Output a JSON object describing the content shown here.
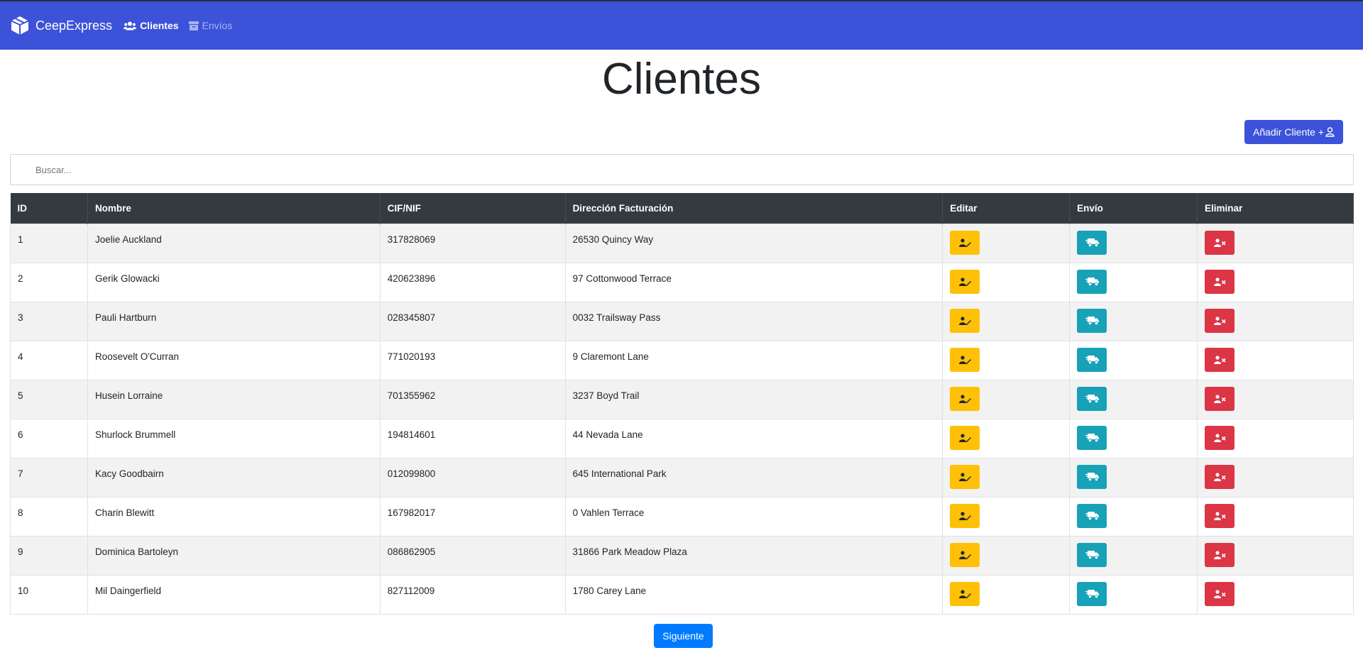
{
  "navbar": {
    "brand": "CeepExpress",
    "links": [
      {
        "label": "Clientes",
        "icon": "users-icon",
        "active": true
      },
      {
        "label": "Envíos",
        "icon": "box-icon",
        "active": false
      }
    ],
    "color": "#3c52d9"
  },
  "page": {
    "title": "Clientes",
    "add_button": "Añadir Cliente +",
    "search_placeholder": "Buscar...",
    "next_button": "Siguiente"
  },
  "table": {
    "headers": [
      "ID",
      "Nombre",
      "CIF/NIF",
      "Dirección Facturación",
      "Editar",
      "Envío",
      "Eliminar"
    ],
    "rows": [
      {
        "id": "1",
        "name": "Joelie Auckland",
        "cif": "317828069",
        "address": "26530 Quincy Way"
      },
      {
        "id": "2",
        "name": "Gerik Glowacki",
        "cif": "420623896",
        "address": "97 Cottonwood Terrace"
      },
      {
        "id": "3",
        "name": "Pauli Hartburn",
        "cif": "028345807",
        "address": "0032 Trailsway Pass"
      },
      {
        "id": "4",
        "name": "Roosevelt O'Curran",
        "cif": "771020193",
        "address": "9 Claremont Lane"
      },
      {
        "id": "5",
        "name": "Husein Lorraine",
        "cif": "701355962",
        "address": "3237 Boyd Trail"
      },
      {
        "id": "6",
        "name": "Shurlock Brummell",
        "cif": "194814601",
        "address": "44 Nevada Lane"
      },
      {
        "id": "7",
        "name": "Kacy Goodbairn",
        "cif": "012099800",
        "address": "645 International Park"
      },
      {
        "id": "8",
        "name": "Charin Blewitt",
        "cif": "167982017",
        "address": "0 Vahlen Terrace"
      },
      {
        "id": "9",
        "name": "Dominica Bartoleyn",
        "cif": "086862905",
        "address": "31866 Park Meadow Plaza"
      },
      {
        "id": "10",
        "name": "Mil Daingerfield",
        "cif": "827112009",
        "address": "1780 Carey Lane"
      }
    ],
    "action_colors": {
      "edit": "#ffc107",
      "ship": "#17a2b8",
      "delete": "#dc3545"
    }
  }
}
